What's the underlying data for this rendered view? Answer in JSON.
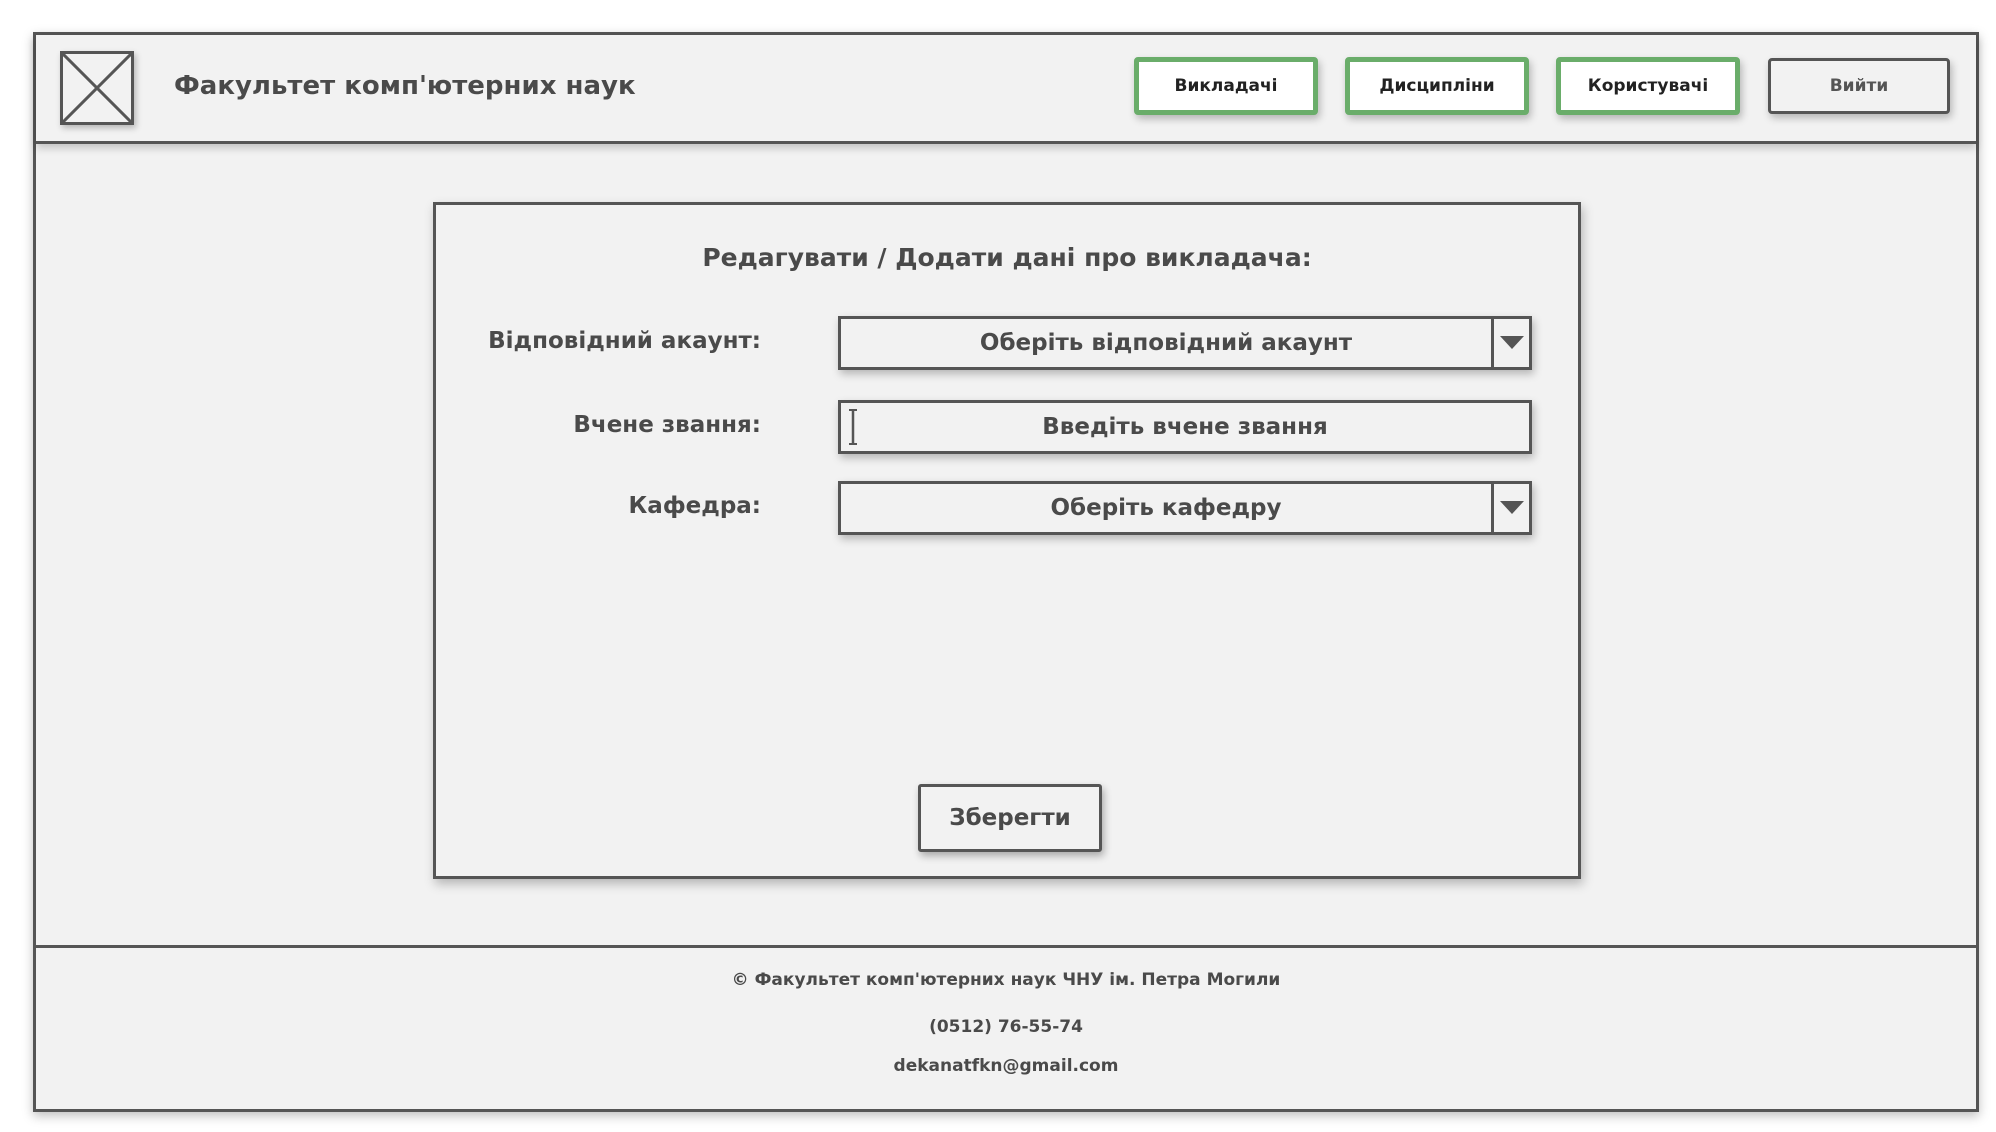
{
  "header": {
    "title": "Факультет комп'ютерних наук",
    "logo_icon": "image-placeholder-icon",
    "nav": [
      {
        "label": "Викладачі"
      },
      {
        "label": "Дисципліни"
      },
      {
        "label": "Користувачі"
      }
    ],
    "logout_label": "Вийти"
  },
  "form": {
    "title": "Редагувати / Додати дані про викладача:",
    "account": {
      "label": "Відповідний акаунт:",
      "placeholder": "Оберіть відповідний акаунт"
    },
    "degree": {
      "label": "Вчене звання:",
      "placeholder": "Введіть вчене звання"
    },
    "department": {
      "label": "Кафедра:",
      "placeholder": "Оберіть кафедру"
    },
    "save_label": "Зберегти"
  },
  "footer": {
    "copyright": "© Факультет комп'ютерних наук ЧНУ ім. Петра Могили",
    "phone": "(0512) 76-55-74",
    "email": "dekanatfkn@gmail.com"
  },
  "colors": {
    "accent_border": "#6aad6a",
    "outline": "#555555",
    "background": "#f2f2f2"
  }
}
